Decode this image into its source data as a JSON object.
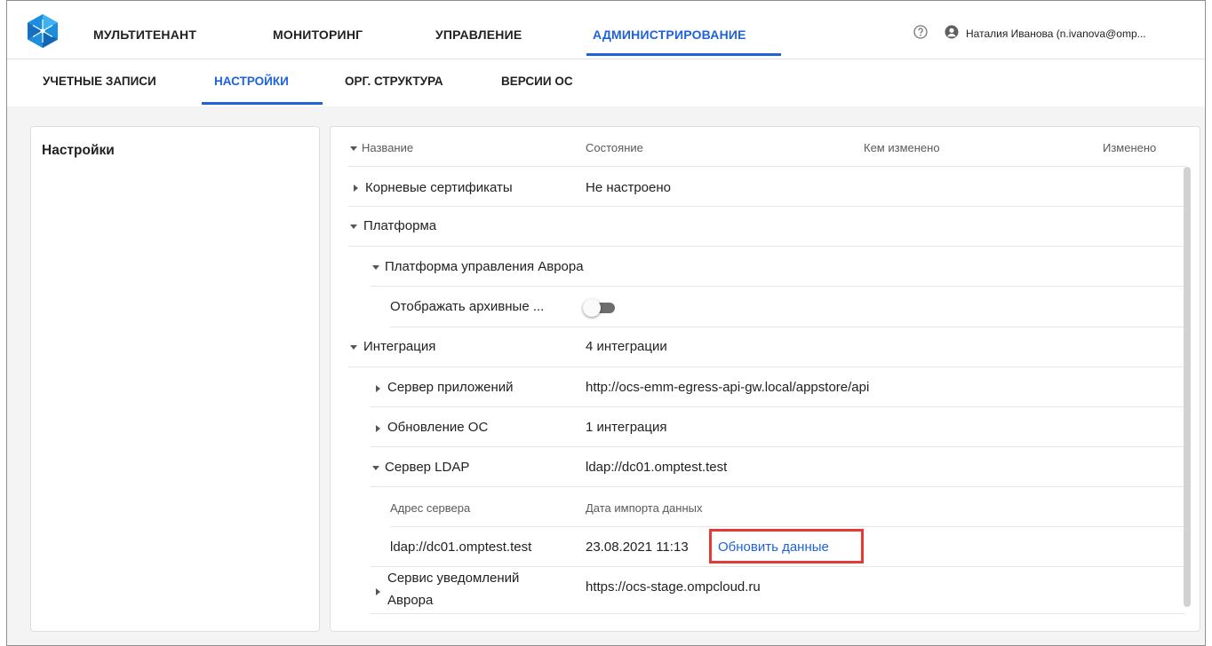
{
  "topnav": {
    "items": [
      "МУЛЬТИТЕНАНТ",
      "МОНИТОРИНГ",
      "УПРАВЛЕНИЕ",
      "АДМИНИСТРИРОВАНИЕ"
    ],
    "active_index": 3,
    "user_name": "Наталия Иванова (n.ivanova@omp..."
  },
  "subnav": {
    "items": [
      "УЧЕТНЫЕ ЗАПИСИ",
      "НАСТРОЙКИ",
      "ОРГ. СТРУКТУРА",
      "ВЕРСИИ ОС"
    ],
    "active_index": 1
  },
  "left_panel": {
    "title": "Настройки"
  },
  "table": {
    "headers": [
      "Название",
      "Состояние",
      "Кем изменено",
      "Изменено"
    ],
    "rows": [
      {
        "name": "Корневые сертификаты",
        "state": "Не настроено",
        "expanded": false
      },
      {
        "name": "Платформа",
        "state": "",
        "expanded": true
      },
      {
        "name": "Платформа управления Аврора",
        "state": "",
        "expanded": true
      },
      {
        "name": "Отображать архивные ...",
        "state": "",
        "toggle_on": false
      },
      {
        "name": "Интеграция",
        "state": "4 интеграции",
        "expanded": true
      },
      {
        "name": "Сервер приложений",
        "state": "http://ocs-emm-egress-api-gw.local/appstore/api",
        "expanded": false
      },
      {
        "name": "Обновление ОС",
        "state": "1 интеграция",
        "expanded": false
      },
      {
        "name": "Сервер LDAP",
        "state": "ldap://dc01.omptest.test",
        "expanded": true
      },
      {
        "name": "Адрес сервера",
        "state": "Дата импорта данных"
      },
      {
        "name": "ldap://dc01.omptest.test",
        "state": "23.08.2021 11:13",
        "action": "Обновить данные"
      },
      {
        "name": "Сервис уведомлений",
        "name2": "Аврора",
        "state": "https://ocs-stage.ompcloud.ru",
        "expanded": false
      }
    ]
  },
  "colors": {
    "accent": "#1f63d8",
    "highlight": "#e53935"
  }
}
